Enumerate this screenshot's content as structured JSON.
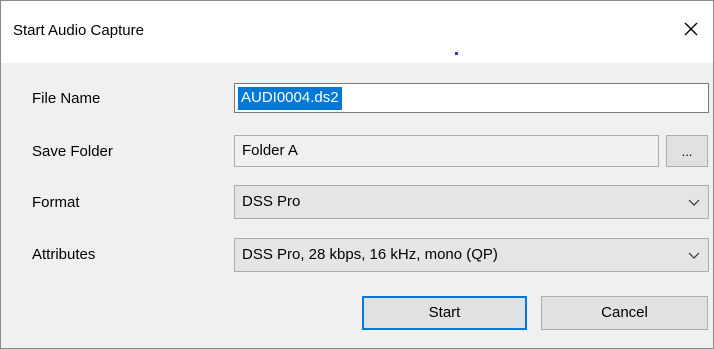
{
  "dialog": {
    "title": "Start Audio Capture",
    "close_icon": "close-icon"
  },
  "fields": {
    "file_name": {
      "label": "File Name",
      "value": "AUDI0004.ds2"
    },
    "save_folder": {
      "label": "Save Folder",
      "value": "Folder A",
      "browse_label": "..."
    },
    "format": {
      "label": "Format",
      "value": "DSS Pro",
      "icon": "chevron-down-icon"
    },
    "attributes": {
      "label": "Attributes",
      "value": "DSS Pro, 28 kbps, 16 kHz, mono (QP)",
      "icon": "chevron-down-icon"
    }
  },
  "buttons": {
    "start": "Start",
    "cancel": "Cancel"
  },
  "colors": {
    "selection": "#0078d7",
    "focus_border": "#0078d7",
    "dialog_background": "#f0f0f0"
  }
}
